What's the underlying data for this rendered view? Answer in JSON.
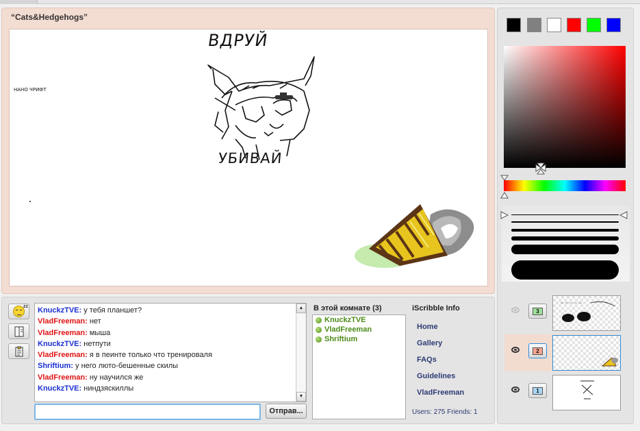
{
  "room": {
    "title": "“Cats&Hedgehogs”"
  },
  "canvas": {
    "handwriting_top": "ВДРУЙ",
    "handwriting_bottom": "УБИВАЙ",
    "handwriting_left": "НАНО ЧРИФТ"
  },
  "chat": {
    "messages": [
      {
        "user": "KnuckzTVE",
        "color": "#1a2fd1",
        "text": "у тебя планшет?"
      },
      {
        "user": "VladFreeman",
        "color": "#e01313",
        "text": "нет"
      },
      {
        "user": "VladFreeman",
        "color": "#e01313",
        "text": "мыша"
      },
      {
        "user": "KnuckzTVE",
        "color": "#1a2fd1",
        "text": "нетпути"
      },
      {
        "user": "VladFreeman",
        "color": "#e01313",
        "text": "я в пеинте только что тренироваля"
      },
      {
        "user": "Shriftium",
        "color": "#1a2fd1",
        "text": "у него люто-бешенные скилы"
      },
      {
        "user": "VladFreeman",
        "color": "#e01313",
        "text": "ну научился же"
      },
      {
        "user": "KnuckzTVE",
        "color": "#1a2fd1",
        "text": "ниндзяскиллы"
      }
    ],
    "input_value": "",
    "send_label": "Отправ...",
    "side_buttons": [
      "smiley-sleep-icon",
      "dictionary-icon",
      "clipboard-icon"
    ]
  },
  "room_users": {
    "heading": "В этой комнате (3)",
    "users": [
      "KnuckzTVE",
      "VladFreeman",
      "Shriftium"
    ]
  },
  "info": {
    "heading": "iScribble Info",
    "links": [
      "Home",
      "Gallery",
      "FAQs",
      "Guidelines",
      "VladFreeman"
    ],
    "stats": "Users: 275 Friends: 1"
  },
  "palette": {
    "swatches": [
      "#000000",
      "#808080",
      "#ffffff",
      "#ff0000",
      "#00ff00",
      "#0000ff"
    ],
    "selected_color": "#000000"
  },
  "brush": {
    "sizes": [
      "1",
      "2",
      "4",
      "6",
      "14",
      "28"
    ],
    "selected_size": "1"
  },
  "layers": [
    {
      "number": "3",
      "color": "#9fe09a",
      "visible": false,
      "active": false
    },
    {
      "number": "2",
      "color": "#f3a58f",
      "visible": true,
      "active": true
    },
    {
      "number": "1",
      "color": "#a8d8f4",
      "visible": true,
      "active": false
    }
  ]
}
